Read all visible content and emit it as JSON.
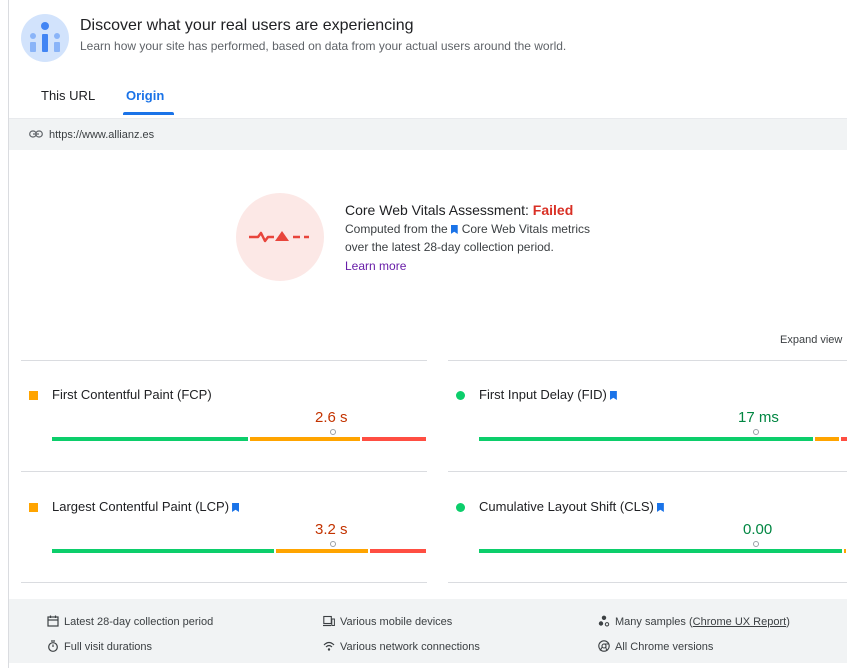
{
  "header": {
    "title": "Discover what your real users are experiencing",
    "subtitle": "Learn how your site has performed, based on data from your actual users around the world."
  },
  "tabs": [
    {
      "label": "This URL",
      "active": false
    },
    {
      "label": "Origin",
      "active": true
    }
  ],
  "url": "https://www.allianz.es",
  "assessment": {
    "heading_prefix": "Core Web Vitals Assessment:",
    "status": "Failed",
    "line1_prefix": "Computed from the",
    "line1_suffix": "Core Web Vitals metrics",
    "line2": "over the latest 28-day collection period.",
    "learn_more": "Learn more"
  },
  "expand_label": "Expand view",
  "metrics": [
    {
      "name": "First Contentful Paint (FCP)",
      "value": "2.6 s",
      "rating": "needs-improvement",
      "core_vital": false,
      "distribution": {
        "good": 0.53,
        "needs_improvement": 0.3,
        "poor": 0.17
      },
      "percentile_position": 0.75
    },
    {
      "name": "First Input Delay (FID)",
      "value": "17 ms",
      "rating": "good",
      "core_vital": true,
      "distribution": {
        "good": 0.91,
        "needs_improvement": 0.07,
        "poor": 0.02
      },
      "percentile_position": 0.75
    },
    {
      "name": "Largest Contentful Paint (LCP)",
      "value": "3.2 s",
      "rating": "needs-improvement",
      "core_vital": true,
      "distribution": {
        "good": 0.6,
        "needs_improvement": 0.25,
        "poor": 0.15
      },
      "percentile_position": 0.75
    },
    {
      "name": "Cumulative Layout Shift (CLS)",
      "value": "0.00",
      "rating": "good",
      "core_vital": true,
      "distribution": {
        "good": 0.99,
        "needs_improvement": 0.01,
        "poor": 0.0
      },
      "percentile_position": 0.75
    }
  ],
  "footer": {
    "period": "Latest 28-day collection period",
    "devices": "Various mobile devices",
    "samples_prefix": "Many samples (",
    "samples_link": "Chrome UX Report",
    "samples_suffix": ")",
    "durations": "Full visit durations",
    "network": "Various network connections",
    "versions": "All Chrome versions"
  },
  "colors": {
    "accent": "#1a73e8",
    "good": "#0cce6b",
    "needs_improvement": "#ffa400",
    "poor": "#ff4e42",
    "failed": "#d93025"
  }
}
